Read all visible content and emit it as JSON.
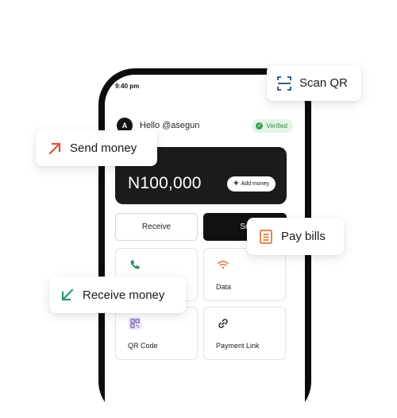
{
  "status_bar": {
    "time": "9:40 pm"
  },
  "header": {
    "avatar_initial": "A",
    "greeting": "Hello @asegun",
    "verified_label": "Verified"
  },
  "balance": {
    "amount": "N100,000",
    "add_money_label": "Add money"
  },
  "actions": {
    "receive_label": "Receive",
    "send_label": "Se"
  },
  "tiles": [
    {
      "label": "",
      "icon": "phone-icon"
    },
    {
      "label": "Data",
      "icon": "wifi-icon"
    },
    {
      "label": "QR Code",
      "icon": "qr-code-icon"
    },
    {
      "label": "Payment Link",
      "icon": "link-icon"
    }
  ],
  "callouts": {
    "scan_qr": {
      "label": "Scan QR",
      "icon": "scan-qr-icon",
      "color": "#2b4a7a"
    },
    "send_money": {
      "label": "Send money",
      "icon": "arrow-up-right-icon",
      "color": "#d9523f"
    },
    "pay_bills": {
      "label": "Pay bills",
      "icon": "bill-icon",
      "color": "#e07c3e"
    },
    "receive_money": {
      "label": "Receive money",
      "icon": "arrow-down-left-icon",
      "color": "#2a9a6c"
    }
  },
  "colors": {
    "card_background": "#1b1b1b",
    "verified_green": "#2f8a46",
    "phone_icon_green": "#2e8f5e",
    "wifi_icon_orange": "#e07c3e",
    "qr_icon_purple": "#7a5ab8"
  }
}
